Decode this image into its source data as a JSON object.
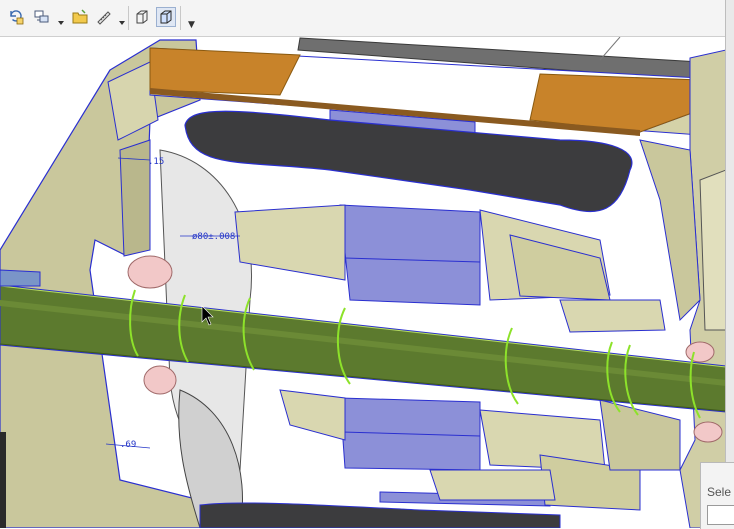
{
  "toolbar": {
    "buttons": [
      {
        "name": "refit-icon"
      },
      {
        "name": "view-manager-icon"
      },
      {
        "name": "open-folder-icon"
      },
      {
        "name": "measure-ruler-icon"
      },
      {
        "name": "wireframe-cube-icon"
      },
      {
        "name": "shaded-cube-icon"
      }
    ],
    "more_label": "▼"
  },
  "viewport": {
    "dimensions": {
      "dim_top": ".15",
      "dim_mid": "ø80±.008",
      "dim_bottom": ".69"
    }
  },
  "selection_panel": {
    "label": "Sele"
  },
  "colors": {
    "shaft_green": "#5c7a2e",
    "housing_beige": "#c9c79c",
    "stator_blue": "#8c90d8",
    "winding_dark": "#3c3c3e",
    "copper_orange": "#c8832a",
    "bearing_pink": "#f2c8c8",
    "outline_blue": "#2a2fd0"
  }
}
